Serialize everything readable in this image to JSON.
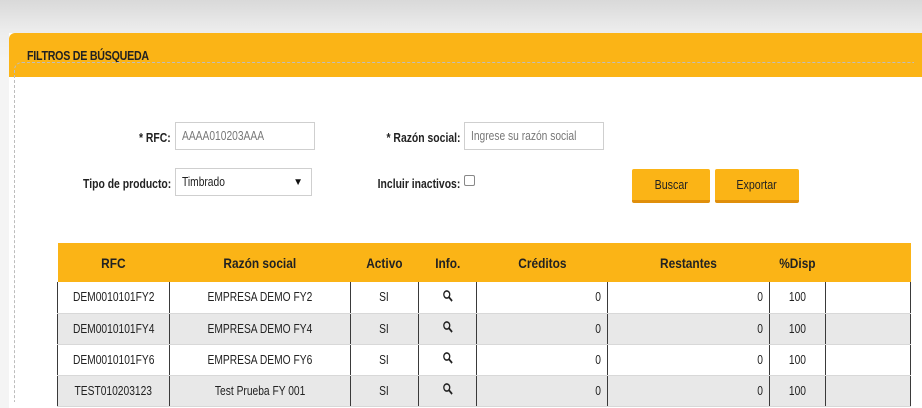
{
  "panel": {
    "title": "FILTROS DE BÚSQUEDA"
  },
  "filters": {
    "rfc_label": "* RFC:",
    "rfc_placeholder": "AAAA010203AAA",
    "razon_label": "* Razón social:",
    "razon_placeholder": "Ingrese su razón social",
    "tipo_label": "Tipo de producto:",
    "tipo_value": "Timbrado",
    "inactivos_label": "Incluir inactivos:"
  },
  "buttons": {
    "buscar": "Buscar",
    "exportar": "Exportar"
  },
  "colors": {
    "accent": "#fbb416",
    "accent_dark": "#e08f0b"
  },
  "table": {
    "headers": [
      "RFC",
      "Razón social",
      "Activo",
      "Info.",
      "Créditos",
      "Restantes",
      "%Disp"
    ],
    "rows": [
      {
        "rfc": "DEM0010101FY2",
        "razon": "EMPRESA DEMO FY2",
        "activo": "SI",
        "info": "search-icon",
        "creditos": "0",
        "restantes": "0",
        "disp": "100"
      },
      {
        "rfc": "DEM0010101FY4",
        "razon": "EMPRESA DEMO FY4",
        "activo": "SI",
        "info": "search-icon",
        "creditos": "0",
        "restantes": "0",
        "disp": "100"
      },
      {
        "rfc": "DEM0010101FY6",
        "razon": "EMPRESA DEMO FY6",
        "activo": "SI",
        "info": "search-icon",
        "creditos": "0",
        "restantes": "0",
        "disp": "100"
      },
      {
        "rfc": "TEST010203123",
        "razon": "Test Prueba FY 001",
        "activo": "SI",
        "info": "search-icon",
        "creditos": "0",
        "restantes": "0",
        "disp": "100"
      }
    ]
  }
}
